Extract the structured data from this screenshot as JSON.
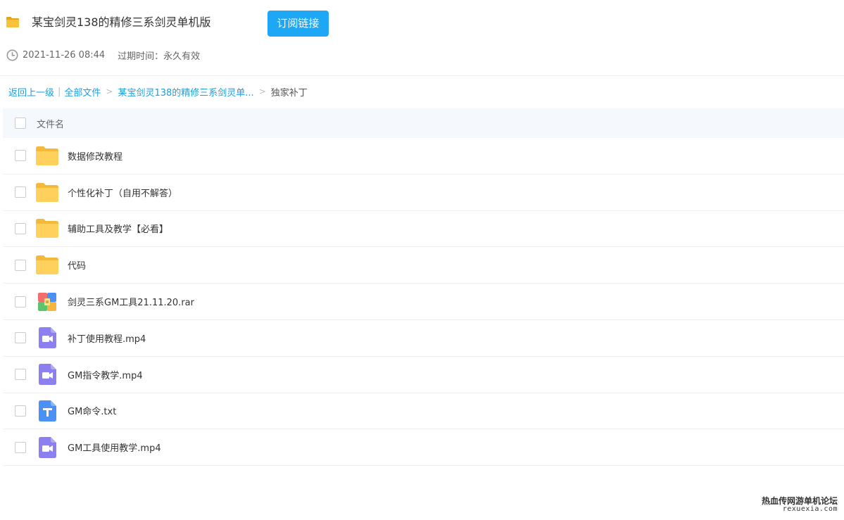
{
  "share": {
    "title": "某宝剑灵138的精修三系剑灵单机版",
    "subscribe_label": "订阅链接",
    "date": "2021-11-26 08:44",
    "expiry": "过期时间：永久有效"
  },
  "breadcrumb": {
    "back": "返回上一级",
    "sep": "|",
    "all_files": "全部文件",
    "parent": "某宝剑灵138的精修三系剑灵单...",
    "current": "独家补丁",
    "gt": ">"
  },
  "table": {
    "header": "文件名",
    "rows": [
      {
        "name": "数据修改教程",
        "type": "folder"
      },
      {
        "name": "个性化补丁（自用不解答）",
        "type": "folder"
      },
      {
        "name": "辅助工具及教学【必看】",
        "type": "folder"
      },
      {
        "name": "代码",
        "type": "folder"
      },
      {
        "name": "剑灵三系GM工具21.11.20.rar",
        "type": "archive"
      },
      {
        "name": "补丁使用教程.mp4",
        "type": "video"
      },
      {
        "name": "GM指令教学.mp4",
        "type": "video"
      },
      {
        "name": "GM命令.txt",
        "type": "text"
      },
      {
        "name": "GM工具使用教学.mp4",
        "type": "video"
      }
    ]
  },
  "watermark": {
    "cn": "热血传网游单机论坛",
    "en": "rexuexia.com"
  },
  "colors": {
    "accent": "#1ea7f4",
    "link": "#1a9fe0",
    "folder": "#ffd15c",
    "video": "#8c7ff0",
    "text_file": "#4a90f5"
  },
  "icons": {
    "folder": "folder-icon",
    "archive": "archive-icon",
    "video": "video-file-icon",
    "text": "text-file-icon",
    "clock": "clock-icon"
  }
}
